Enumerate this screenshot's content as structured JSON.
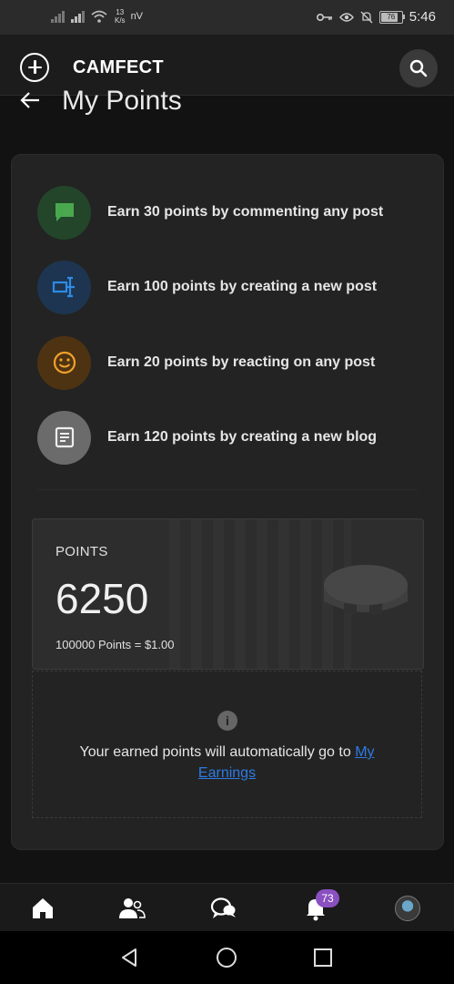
{
  "status_bar": {
    "net_speed_value": "13",
    "net_speed_unit": "K/s",
    "carrier_text": "nV",
    "battery": "76",
    "time": "5:46"
  },
  "header": {
    "brand": "CAMFECT",
    "logo_icon": "plus-circle-icon",
    "search_icon": "search-icon"
  },
  "page": {
    "title": "My Points"
  },
  "earn_items": [
    {
      "label": "Earn 30 points by commenting any post",
      "icon": "comment-icon",
      "color": "#2e5d33",
      "icon_color": "#4caf50"
    },
    {
      "label": "Earn 100 points by creating a new post",
      "icon": "create-post-icon",
      "color": "#1f3a5a",
      "icon_color": "#2e8be6"
    },
    {
      "label": "Earn 20 points by reacting on any post",
      "icon": "smile-icon",
      "color": "#5a3a12",
      "icon_color": "#f2a12b"
    },
    {
      "label": "Earn 120 points by creating a new blog",
      "icon": "blog-icon",
      "color": "#6e6e6e",
      "icon_color": "#eaeaea"
    }
  ],
  "points": {
    "label": "POINTS",
    "value": "6250",
    "rate": "100000 Points = $1.00",
    "coin_icon": "coin-stack-icon"
  },
  "info": {
    "text": "Your earned points will automatically go to ",
    "link": "My Earnings"
  },
  "bottom_nav": {
    "items": [
      "home-icon",
      "friends-icon",
      "chat-icon",
      "notifications-icon",
      "profile-avatar"
    ],
    "notification_count": "73"
  }
}
